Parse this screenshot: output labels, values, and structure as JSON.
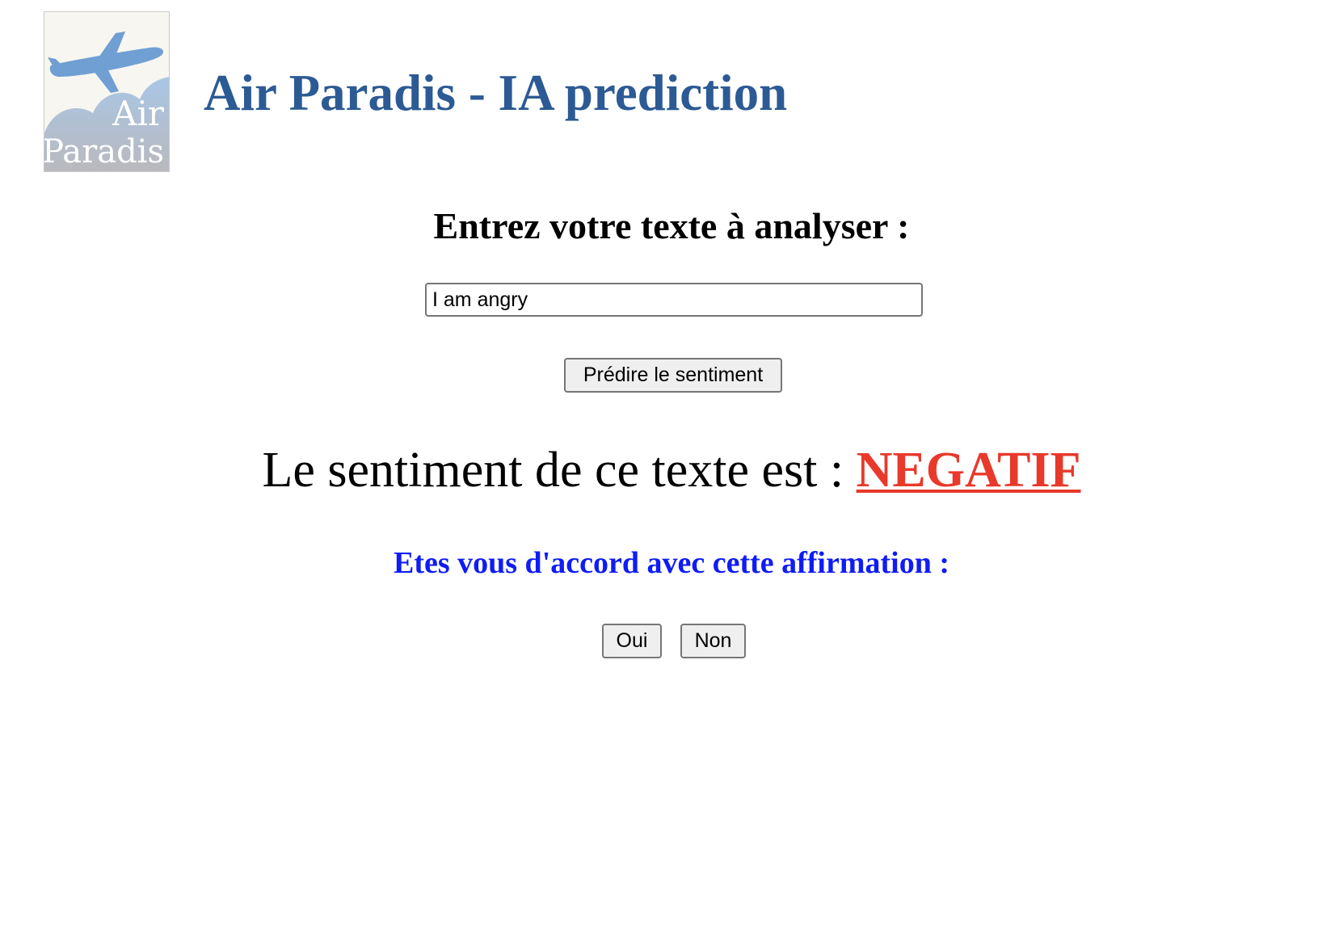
{
  "header": {
    "logo_text_line1": "Air",
    "logo_text_line2": "Paradis",
    "title": "Air Paradis - IA prediction"
  },
  "form": {
    "heading": "Entrez votre texte à analyser :",
    "input_value": "I am angry",
    "predict_button_label": "Prédire le sentiment"
  },
  "result": {
    "prefix": "Le sentiment de ce texte est : ",
    "value": "NEGATIF",
    "value_color": "#e8392b"
  },
  "feedback": {
    "question": "Etes vous d'accord avec cette affirmation :",
    "question_color": "#0f1cf5",
    "yes_label": "Oui",
    "no_label": "Non"
  },
  "colors": {
    "title": "#2c5a94",
    "logo_plane": "#6f9fd3",
    "logo_cloud": "#9dbde0"
  }
}
